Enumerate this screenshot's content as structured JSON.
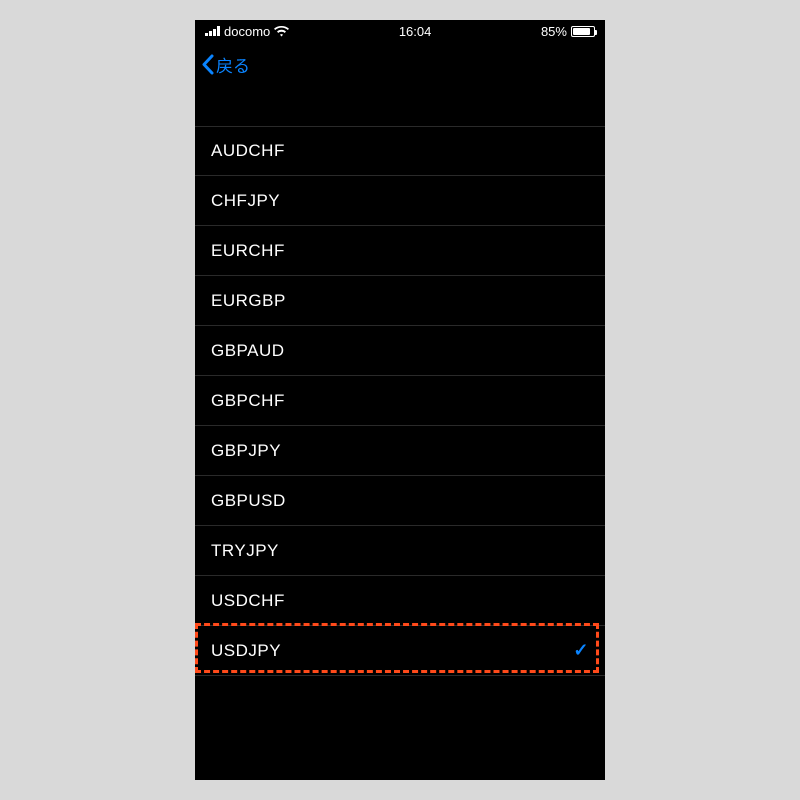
{
  "statusbar": {
    "carrier": "docomo",
    "time": "16:04",
    "battery_text": "85%",
    "battery_pct": 85
  },
  "navbar": {
    "back_label": "戻る"
  },
  "list": {
    "items": [
      {
        "label": "AUDCHF",
        "selected": false
      },
      {
        "label": "CHFJPY",
        "selected": false
      },
      {
        "label": "EURCHF",
        "selected": false
      },
      {
        "label": "EURGBP",
        "selected": false
      },
      {
        "label": "GBPAUD",
        "selected": false
      },
      {
        "label": "GBPCHF",
        "selected": false
      },
      {
        "label": "GBPJPY",
        "selected": false
      },
      {
        "label": "GBPUSD",
        "selected": false
      },
      {
        "label": "TRYJPY",
        "selected": false
      },
      {
        "label": "USDCHF",
        "selected": false
      },
      {
        "label": "USDJPY",
        "selected": true
      }
    ]
  },
  "annotation": {
    "highlight_index": 10
  }
}
